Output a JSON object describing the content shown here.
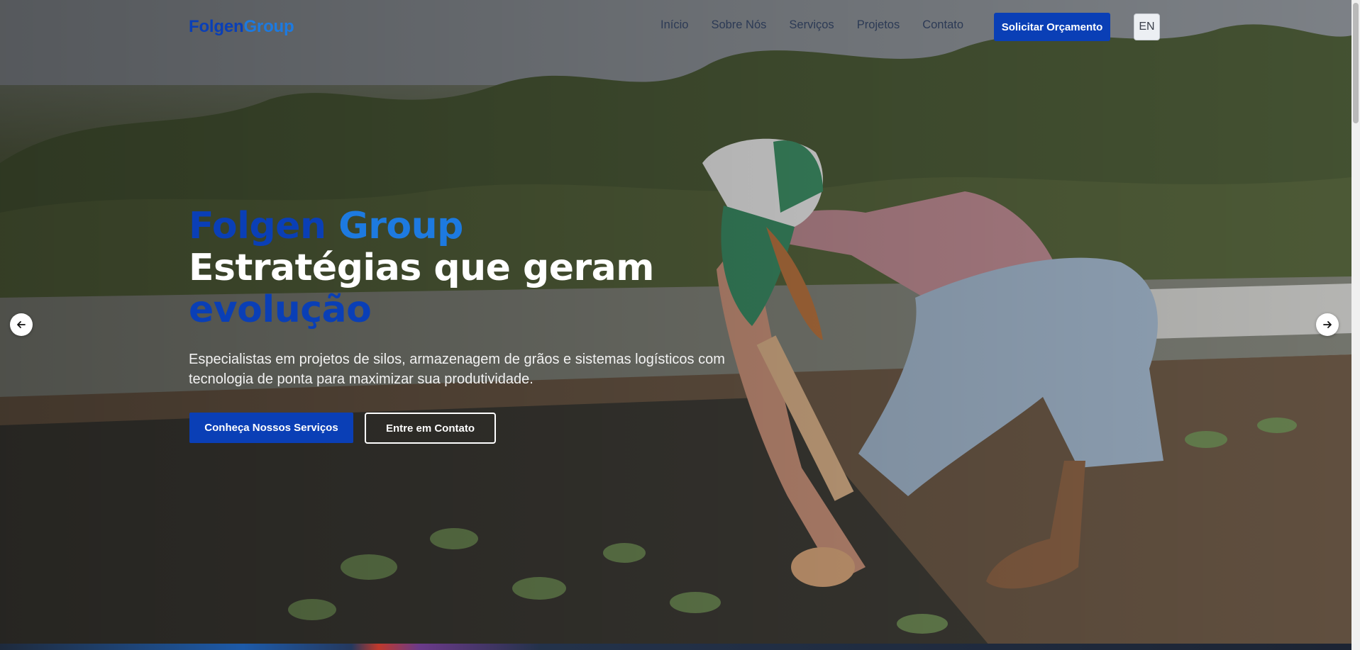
{
  "header": {
    "logo_part1": "Folgen",
    "logo_part2": "Group",
    "menu": [
      "Início",
      "Sobre Nós",
      "Serviços",
      "Projetos",
      "Contato"
    ],
    "quote_button": "Solicitar Orçamento",
    "language_button": "EN"
  },
  "hero": {
    "title_part1": "Folgen",
    "title_part2": "Group",
    "title_line2": "Estratégias que geram",
    "title_line3": "evolução",
    "subtitle": "Especialistas em projetos de silos, armazenagem de grãos e sistemas logísticos com tecnologia de ponta para maximizar sua produtividade.",
    "primary_button": "Conheça Nossos Serviços",
    "secondary_button": "Entre em Contato"
  },
  "carousel": {
    "prev_icon": "arrow-left-icon",
    "next_icon": "arrow-right-icon"
  },
  "colors": {
    "brand_dark": "#0a3fb6",
    "brand_light": "#1d7ae0"
  }
}
